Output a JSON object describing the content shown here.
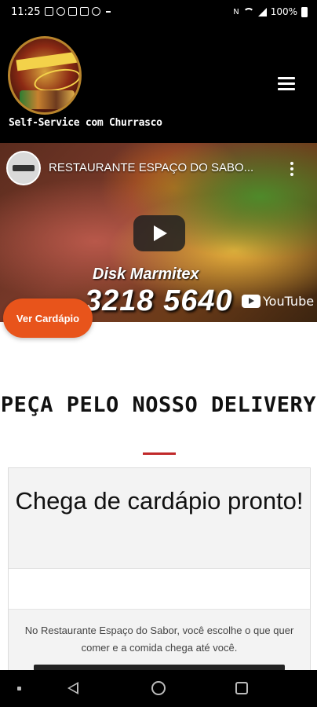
{
  "status_bar": {
    "time": "11:25",
    "battery": "100%",
    "icons": [
      "sim-icon",
      "facebook-icon",
      "facebook-icon",
      "news-icon",
      "instagram-icon",
      "nfc-icon",
      "wifi-icon",
      "signal-icon",
      "battery-icon"
    ]
  },
  "header": {
    "tagline": "Self-Service com Churrasco",
    "menu_icon": "hamburger-icon"
  },
  "video": {
    "title": "RESTAURANTE ESPAÇO DO SABO...",
    "overlay_line1": "Disk Marmitex",
    "overlay_phone": "3218 5640",
    "platform": "YouTube",
    "play_icon": "play-icon"
  },
  "cta": {
    "label": "Ver Cardápio"
  },
  "main": {
    "heading": "PEÇA PELO NOSSO DELIVERY",
    "card_title": "Chega de cardápio pronto!",
    "card_text": "No Restaurante Espaço do Sabor, você escolhe o que quer comer e a comida chega até você."
  },
  "nav_bar": {
    "buttons": [
      "back-icon",
      "home-icon",
      "recents-icon"
    ]
  },
  "colors": {
    "accent": "#e8541b",
    "divider": "#c0292a",
    "header_bg": "#000000"
  }
}
